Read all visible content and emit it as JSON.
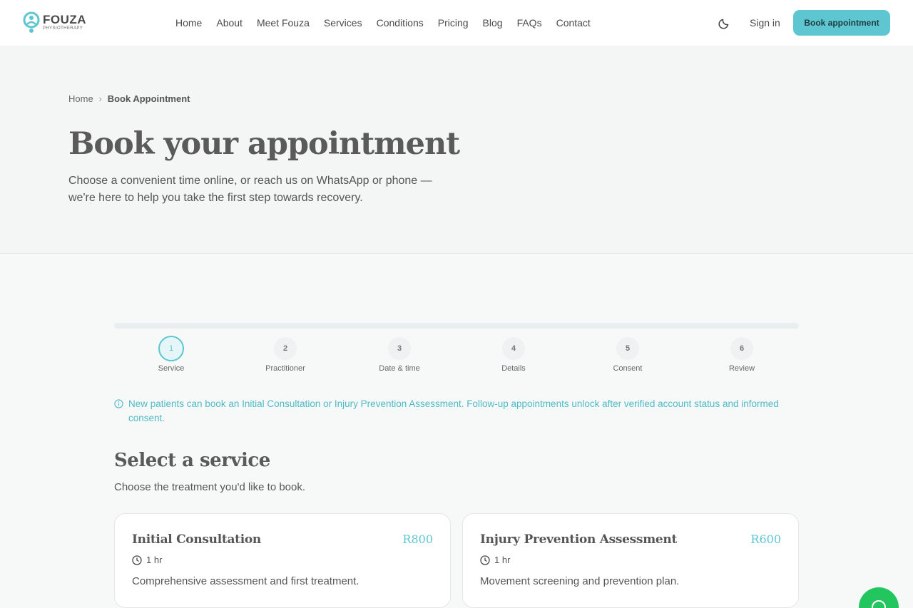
{
  "brand": {
    "name": "FOUZA",
    "tagline": "PHYSIOTHERAPY"
  },
  "nav": {
    "links": [
      "Home",
      "About",
      "Meet Fouza",
      "Services",
      "Conditions",
      "Pricing",
      "Blog",
      "FAQs",
      "Contact"
    ],
    "theme_icon": "moon-icon",
    "sign_in": "Sign in",
    "cta": "Book appointment"
  },
  "breadcrumb": {
    "home": "Home",
    "separator": "›",
    "current": "Book Appointment"
  },
  "hero": {
    "title": "Book your appointment",
    "subtitle": "Choose a convenient time online, or reach us on WhatsApp or phone — we're here to help you take the first step towards recovery."
  },
  "steps": [
    {
      "number": "1",
      "label": "Service",
      "active": true
    },
    {
      "number": "2",
      "label": "Practitioner",
      "active": false
    },
    {
      "number": "3",
      "label": "Date & time",
      "active": false
    },
    {
      "number": "4",
      "label": "Details",
      "active": false
    },
    {
      "number": "5",
      "label": "Consent",
      "active": false
    },
    {
      "number": "6",
      "label": "Review",
      "active": false
    }
  ],
  "notice": {
    "icon": "info-icon",
    "text": "New patients can book an Initial Consultation or Injury Prevention Assessment. Follow-up appointments unlock after verified account status and informed consent."
  },
  "service_section": {
    "title": "Select a service",
    "subtitle": "Choose the treatment you'd like to book."
  },
  "services": [
    {
      "name": "Initial Consultation",
      "price": "R800",
      "duration": "1 hr",
      "description": "Comprehensive assessment and first treatment."
    },
    {
      "name": "Injury Prevention Assessment",
      "price": "R600",
      "duration": "1 hr",
      "description": "Movement screening and prevention plan."
    }
  ],
  "colors": {
    "accent": "#5dc6d1",
    "chat": "#22c55e",
    "text": "#5a5a5a"
  },
  "chat_icon": "whatsapp-chat-icon"
}
